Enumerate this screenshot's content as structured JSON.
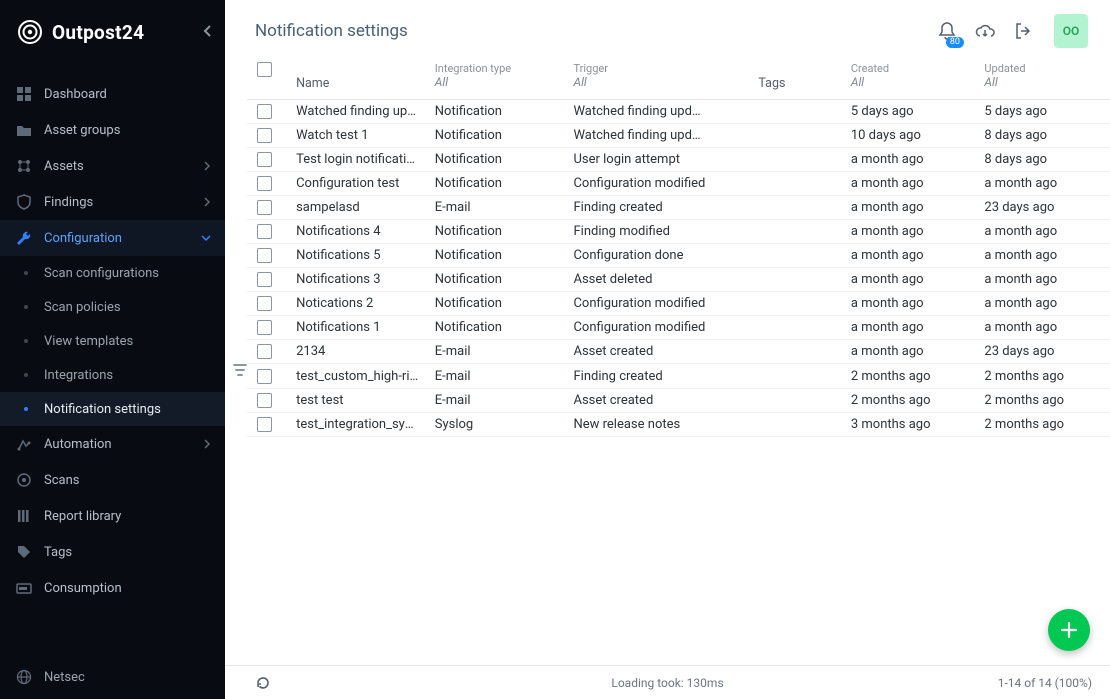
{
  "brand": "Outpost24",
  "page": {
    "title": "Notification settings"
  },
  "header": {
    "bell_badge": "80",
    "avatar_initials": "OO"
  },
  "sidebar": {
    "items": [
      {
        "label": "Dashboard"
      },
      {
        "label": "Asset groups"
      },
      {
        "label": "Assets",
        "chev": true
      },
      {
        "label": "Findings",
        "chev": true
      },
      {
        "label": "Configuration",
        "chev": true,
        "active": true
      },
      {
        "label": "Automation",
        "chev": true
      },
      {
        "label": "Scans"
      },
      {
        "label": "Report library"
      },
      {
        "label": "Tags"
      },
      {
        "label": "Consumption"
      }
    ],
    "config_sub": [
      {
        "label": "Scan configurations"
      },
      {
        "label": "Scan policies"
      },
      {
        "label": "View templates"
      },
      {
        "label": "Integrations"
      },
      {
        "label": "Notification settings",
        "active": true
      }
    ],
    "footer": {
      "label": "Netsec"
    }
  },
  "columns": {
    "name": {
      "label": "Name"
    },
    "integration": {
      "top": "Integration type",
      "filter": "All"
    },
    "trigger": {
      "top": "Trigger",
      "filter": "All"
    },
    "tags": {
      "label": "Tags"
    },
    "created": {
      "top": "Created",
      "filter": "All"
    },
    "updated": {
      "top": "Updated",
      "filter": "All"
    }
  },
  "rows": [
    {
      "name": "Watched finding upd…",
      "type": "Notification",
      "trigger": "Watched finding upd…",
      "tags": "",
      "created": "5 days ago",
      "updated": "5 days ago"
    },
    {
      "name": "Watch test 1",
      "type": "Notification",
      "trigger": "Watched finding upd…",
      "tags": "",
      "created": "10 days ago",
      "updated": "8 days ago"
    },
    {
      "name": "Test login notification",
      "type": "Notification",
      "trigger": "User login attempt",
      "tags": "",
      "created": "a month ago",
      "updated": "8 days ago"
    },
    {
      "name": "Configuration test",
      "type": "Notification",
      "trigger": "Configuration modified",
      "tags": "",
      "created": "a month ago",
      "updated": "a month ago"
    },
    {
      "name": "sampelasd",
      "type": "E-mail",
      "trigger": "Finding created",
      "tags": "",
      "created": "a month ago",
      "updated": "23 days ago"
    },
    {
      "name": "Notifications 4",
      "type": "Notification",
      "trigger": "Finding modified",
      "tags": "",
      "created": "a month ago",
      "updated": "a month ago"
    },
    {
      "name": "Notifications 5",
      "type": "Notification",
      "trigger": "Configuration done",
      "tags": "",
      "created": "a month ago",
      "updated": "a month ago"
    },
    {
      "name": "Notifications 3",
      "type": "Notification",
      "trigger": "Asset deleted",
      "tags": "",
      "created": "a month ago",
      "updated": "a month ago"
    },
    {
      "name": "Notications 2",
      "type": "Notification",
      "trigger": "Configuration modified",
      "tags": "",
      "created": "a month ago",
      "updated": "a month ago"
    },
    {
      "name": "Notifications 1",
      "type": "Notification",
      "trigger": "Configuration modified",
      "tags": "",
      "created": "a month ago",
      "updated": "a month ago"
    },
    {
      "name": "2134",
      "type": "E-mail",
      "trigger": "Asset created",
      "tags": "",
      "created": "a month ago",
      "updated": "23 days ago"
    },
    {
      "name": "test_custom_high-risk",
      "type": "E-mail",
      "trigger": "Finding created",
      "tags": "",
      "created": "2 months ago",
      "updated": "2 months ago"
    },
    {
      "name": "test test",
      "type": "E-mail",
      "trigger": "Asset created",
      "tags": "",
      "created": "2 months ago",
      "updated": "2 months ago"
    },
    {
      "name": "test_integration_sysl…",
      "type": "Syslog",
      "trigger": "New release notes",
      "tags": "",
      "created": "3 months ago",
      "updated": "2 months ago"
    }
  ],
  "status": {
    "loading": "Loading took: 130ms",
    "paging": "1-14 of 14 (100%)"
  }
}
